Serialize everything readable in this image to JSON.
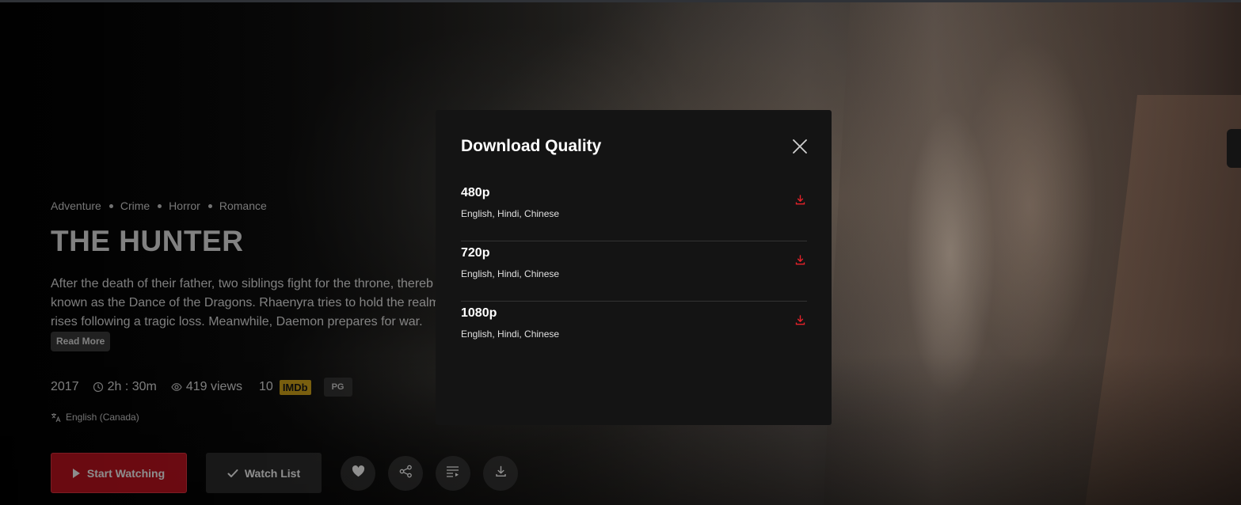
{
  "hero": {
    "genres": [
      "Adventure",
      "Crime",
      "Horror",
      "Romance"
    ],
    "title": "THE HUNTER",
    "description_lines": [
      "After the death of their father, two siblings fight for the throne, thereb",
      "known as the Dance of the Dragons. Rhaenyra tries to hold the realm",
      "rises following a tragic loss. Meanwhile, Daemon prepares for war."
    ],
    "read_more_label": "Read More",
    "year": "2017",
    "runtime": "2h : 30m",
    "views": "419 views",
    "rating": "10",
    "imdb_label": "IMDb",
    "age_rating": "PG",
    "language": "English (Canada)",
    "actions": {
      "start_label": "Start Watching",
      "watchlist_label": "Watch List",
      "icons": [
        "heart-icon",
        "share-icon",
        "playlist-icon",
        "download-icon"
      ]
    }
  },
  "modal": {
    "title": "Download Quality",
    "items": [
      {
        "resolution": "480p",
        "languages": "English, Hindi, Chinese"
      },
      {
        "resolution": "720p",
        "languages": "English, Hindi, Chinese"
      },
      {
        "resolution": "1080p",
        "languages": "English, Hindi, Chinese"
      }
    ]
  },
  "colors": {
    "accent": "#c1121f",
    "download_icon": "#e5222a",
    "imdb": "#d4a514",
    "modal_bg": "#141414"
  }
}
